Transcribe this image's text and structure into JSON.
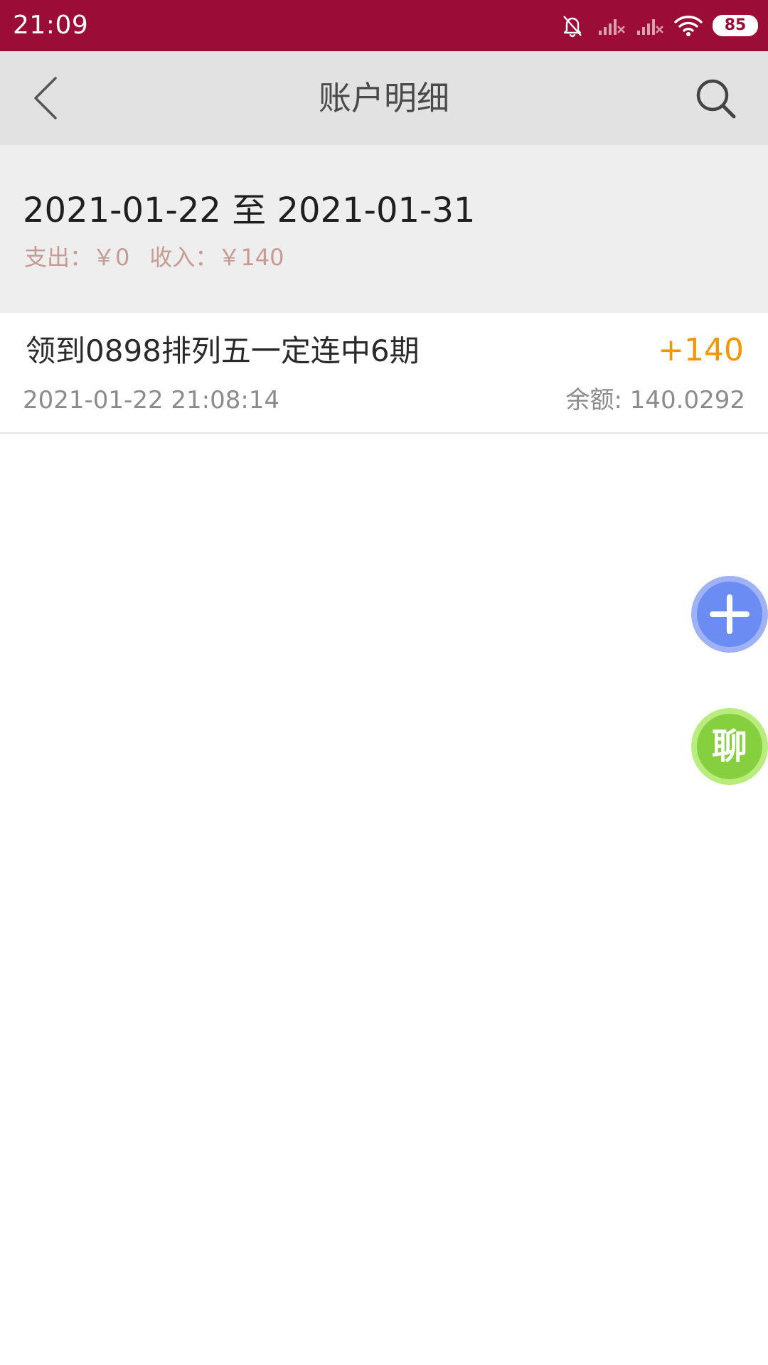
{
  "status_bar": {
    "time": "21:09",
    "battery": "85",
    "icons": [
      "bell-muted-icon",
      "signal-none-icon",
      "signal-none-icon",
      "wifi-icon",
      "battery-icon"
    ],
    "background_color": "#9b0c36"
  },
  "header": {
    "title": "账户明细",
    "back_icon": "chevron-left-icon",
    "search_icon": "search-icon"
  },
  "summary": {
    "date_range": "2021-01-22 至 2021-01-31",
    "expense_label": "支出：",
    "expense_value": "￥0",
    "income_label": "收入：",
    "income_value": "￥140"
  },
  "records": [
    {
      "title": "领到0898排列五一定连中6期",
      "amount": "+140",
      "time": "2021-01-22 21:08:14",
      "balance": "余额: 140.0292"
    }
  ],
  "floating_buttons": {
    "add_icon": "plus-icon",
    "chat_label": "聊"
  },
  "colors": {
    "amount_positive": "#f59500",
    "summary_totals": "#c79a93",
    "add_button": "#6b8cf2",
    "chat_button": "#86d040"
  }
}
